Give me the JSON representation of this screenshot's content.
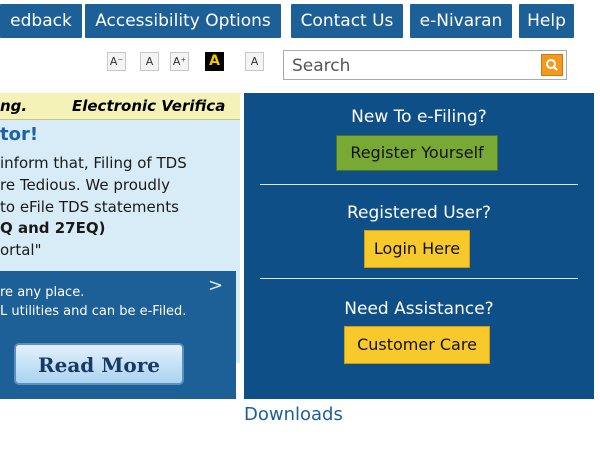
{
  "nav": {
    "items": [
      "edback",
      "Accessibility Options",
      "Contact Us",
      "e-Nivaran",
      "Help"
    ]
  },
  "font_controls": [
    "A⁻",
    "A",
    "A⁺",
    "A",
    "A"
  ],
  "search": {
    "placeholder": "Search"
  },
  "ticker": {
    "left_text": "ng.",
    "right_text": "Electronic Verifica"
  },
  "notice": {
    "heading": "tor!",
    "lines": [
      "inform that, Filing of TDS",
      "re Tedious. We proudly",
      "to eFile TDS statements",
      "Q and 27EQ)",
      "ortal\""
    ],
    "bottom_lines": [
      "re any place.",
      "L utilities and can be e-Filed."
    ],
    "arrow": ">",
    "read_more": "Read More"
  },
  "sidebar": {
    "new_heading": "New To e-Filing?",
    "register_label": "Register Yourself",
    "registered_heading": "Registered User?",
    "login_label": "Login Here",
    "assist_heading": "Need Assistance?",
    "care_label": "Customer Care"
  },
  "downloads": "Downloads",
  "colors": {
    "nav_blue": "#1d5f97",
    "panel_blue": "#0d4f86",
    "register_green": "#78a935",
    "button_yellow": "#f8c92b",
    "ticker_bg": "#f5f2b8",
    "notice_bg": "#d8ecf8"
  },
  "icons": {
    "search": "search-icon"
  }
}
